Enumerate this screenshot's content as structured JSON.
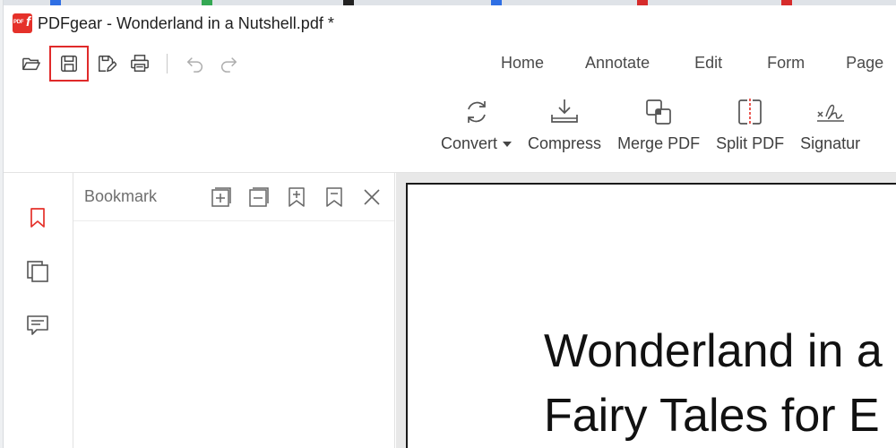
{
  "window": {
    "title": "PDFgear - Wonderland in a Nutshell.pdf *",
    "logo_text": "PDF"
  },
  "quickbar": {
    "items": [
      "open-icon",
      "save-icon",
      "save-as-icon",
      "print-icon",
      "undo-icon",
      "redo-icon"
    ]
  },
  "ribbon": {
    "tabs": [
      {
        "label": "Home"
      },
      {
        "label": "Annotate"
      },
      {
        "label": "Edit"
      },
      {
        "label": "Form"
      },
      {
        "label": "Page"
      }
    ],
    "commands": [
      {
        "label": "Convert",
        "icon": "convert-icon",
        "has_dropdown": true
      },
      {
        "label": "Compress",
        "icon": "compress-icon"
      },
      {
        "label": "Merge PDF",
        "icon": "merge-pdf-icon"
      },
      {
        "label": "Split PDF",
        "icon": "split-pdf-icon"
      },
      {
        "label": "Signatur",
        "icon": "signature-icon"
      }
    ]
  },
  "rail": {
    "items": [
      "bookmark-icon",
      "pages-icon",
      "comment-icon"
    ],
    "active_color": "#e5312a"
  },
  "bookmark_panel": {
    "title": "Bookmark",
    "tools": [
      "expand-all-icon",
      "collapse-all-icon",
      "add-bookmark-icon",
      "remove-bookmark-icon",
      "close-icon"
    ]
  },
  "document": {
    "lines": [
      "Wonderland in a",
      "Fairy Tales for E"
    ]
  },
  "colors": {
    "accent": "#e5312a",
    "highlight_border": "#e02a2a"
  }
}
